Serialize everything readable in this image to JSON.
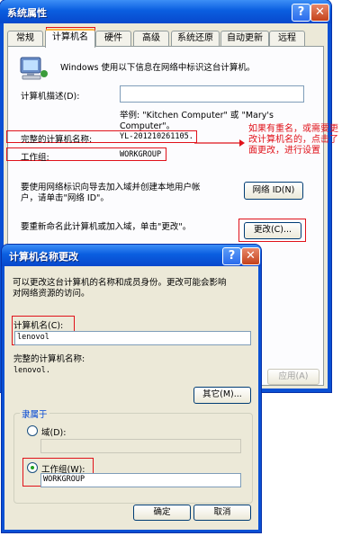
{
  "system_properties": {
    "title": "系统属性",
    "tabs": [
      "常规",
      "计算机名",
      "硬件",
      "高级",
      "系统还原",
      "自动更新",
      "远程"
    ],
    "active_tab": "计算机名",
    "intro_text": "Windows 使用以下信息在网络中标识这台计算机。",
    "description_label": "计算机描述(D):",
    "description_value": "",
    "example_text_line1": "举例: \"Kitchen Computer\" 或 \"Mary's",
    "example_text_line2": "Computer\"。",
    "full_name_label": "完整的计算机名称:",
    "full_name_value": "YL-201210261105.",
    "workgroup_label": "工作组:",
    "workgroup_value": "WORKGROUP",
    "network_id_text_line1": "要使用网络标识向导去加入域并创建本地用户帐",
    "network_id_text_line2": "户，请单击\"网络 ID\"。",
    "network_id_button": "网络 ID(N)",
    "rename_text": "要重新命名此计算机或加入域，单击\"更改\"。",
    "change_button": "更改(C)...",
    "apply_button": "应用(A)"
  },
  "annotation": {
    "line1": "如果有重名，或需要更",
    "line2": "改计算机名的，点击了",
    "line3": "面更改，进行设置"
  },
  "name_change": {
    "title": "计算机名称更改",
    "info_line1": "可以更改这台计算机的名称和成员身份。更改可能会影响",
    "info_line2": "对网络资源的访问。",
    "computer_name_label": "计算机名(C):",
    "computer_name_value": "lenovol",
    "full_name_label": "完整的计算机名称:",
    "full_name_value": "lenovol.",
    "more_button": "其它(M)...",
    "member_of_label": "隶属于",
    "domain_label": "域(D):",
    "domain_value": "",
    "workgroup_label": "工作组(W):",
    "workgroup_value": "WORKGROUP",
    "selected_membership": "workgroup",
    "ok_button": "确定",
    "cancel_button": "取消"
  },
  "colors": {
    "titlebar": "#0a5ee0",
    "dialog_bg": "#ece9d8",
    "annotation_red": "#e0121a"
  }
}
